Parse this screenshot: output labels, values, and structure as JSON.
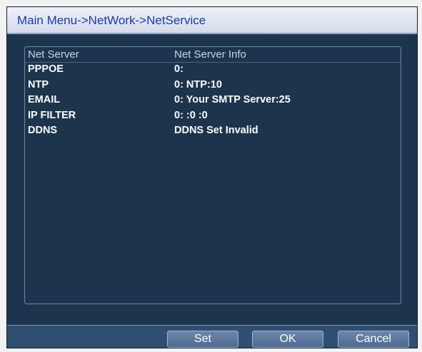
{
  "window": {
    "title": "Main Menu->NetWork->NetService"
  },
  "table": {
    "headers": [
      "Net Server",
      "Net Server Info"
    ],
    "rows": [
      {
        "server": "PPPOE",
        "info": "0:"
      },
      {
        "server": "NTP",
        "info": "0: NTP:10"
      },
      {
        "server": "EMAIL",
        "info": "0: Your SMTP Server:25"
      },
      {
        "server": "IP FILTER",
        "info": "0: :0 :0"
      },
      {
        "server": "DDNS",
        "info": "DDNS Set Invalid"
      }
    ]
  },
  "buttons": {
    "set": "Set",
    "ok": "OK",
    "cancel": "Cancel"
  },
  "colors": {
    "background": "#1c344c",
    "title_text": "#1a3aa0",
    "text": "#ffffff"
  }
}
